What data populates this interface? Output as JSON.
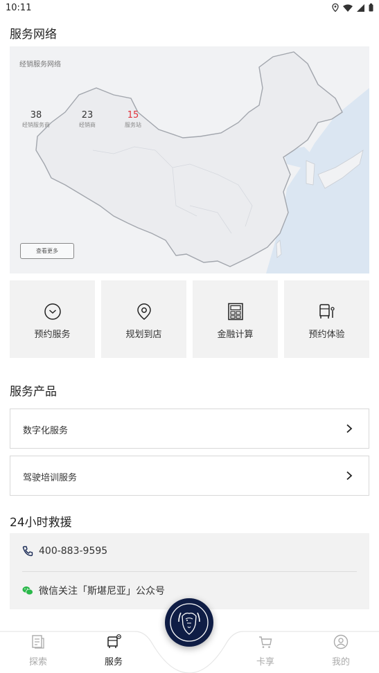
{
  "status_bar": {
    "time": "10:11"
  },
  "network": {
    "title": "服务网络",
    "map_caption": "经销服务网络",
    "stats": [
      {
        "value": "38",
        "label": "经销服务商"
      },
      {
        "value": "23",
        "label": "经销商"
      },
      {
        "value": "15",
        "label": "服务站"
      }
    ],
    "more_label": "查看更多"
  },
  "quick_actions": [
    {
      "label": "预约服务",
      "icon": "clock-icon"
    },
    {
      "label": "规划到店",
      "icon": "location-pin-icon"
    },
    {
      "label": "金融计算",
      "icon": "calculator-icon"
    },
    {
      "label": "预约体验",
      "icon": "truck-driver-icon"
    }
  ],
  "products": {
    "title": "服务产品",
    "items": [
      {
        "label": "数字化服务"
      },
      {
        "label": "驾驶培训服务"
      }
    ]
  },
  "rescue": {
    "title": "24小时救援",
    "phone": "400-883-9595",
    "wechat": "微信关注「斯堪尼亚」公众号"
  },
  "tabbar": {
    "items": [
      {
        "label": "探索",
        "icon": "explore-icon"
      },
      {
        "label": "服务",
        "icon": "service-truck-icon"
      },
      {
        "label": "卡享",
        "icon": "cart-icon"
      },
      {
        "label": "我的",
        "icon": "profile-icon"
      }
    ],
    "active_index": 1,
    "center_logo": "scania-griffin-logo"
  },
  "colors": {
    "accent_red": "#e0303a",
    "logo_navy": "#0f1d45",
    "card_bg": "#f2f2f2",
    "sea": "#dbe6f2"
  }
}
